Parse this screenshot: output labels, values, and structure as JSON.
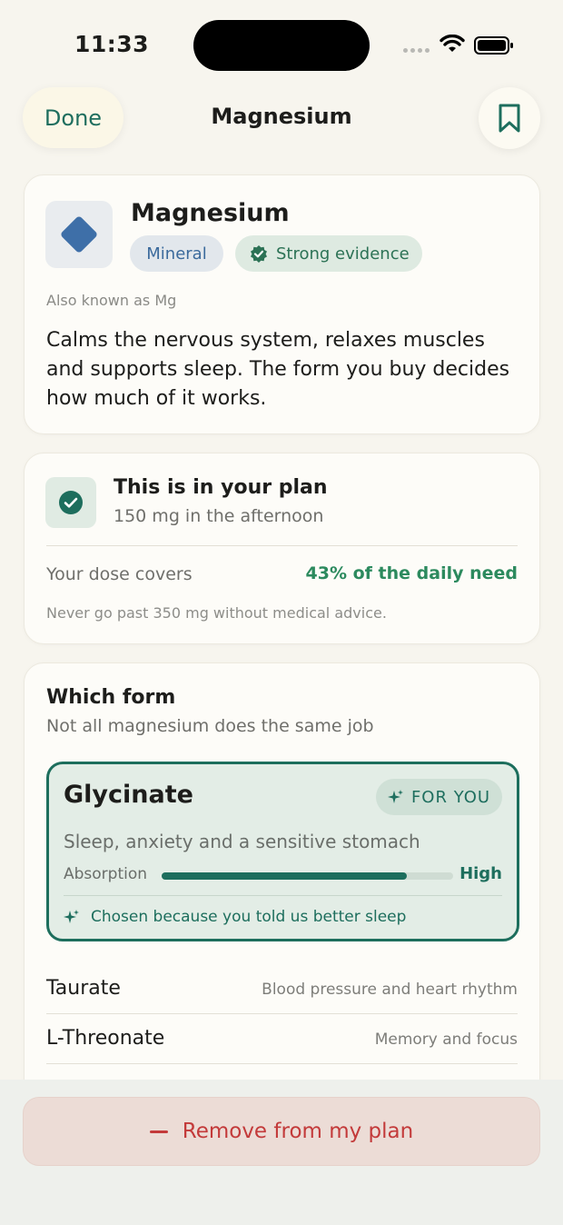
{
  "status_bar": {
    "time": "11:33"
  },
  "nav": {
    "done_label": "Done",
    "title": "Magnesium"
  },
  "supplement": {
    "name": "Magnesium",
    "category": "Mineral",
    "evidence": "Strong evidence",
    "aka": "Also known as Mg",
    "description": "Calms the nervous system, relaxes muscles and supports sleep. The form you buy decides how much of it works."
  },
  "plan": {
    "title": "This is in your plan",
    "dose": "150 mg in the afternoon",
    "covers_label": "Your dose covers",
    "covers_value": "43% of the daily need",
    "warning": "Never go past 350 mg without medical advice."
  },
  "forms": {
    "title": "Which form",
    "subtitle": "Not all magnesium does the same job",
    "recommended": {
      "name": "Glycinate",
      "badge": "FOR YOU",
      "use": "Sleep, anxiety and a sensitive stomach",
      "absorption_label": "Absorption",
      "absorption_level": 0.84,
      "absorption_value": "High",
      "reason": "Chosen because you told us better sleep"
    },
    "others": [
      {
        "name": "Taurate",
        "use": "Blood pressure and heart rhythm"
      },
      {
        "name": "L-Threonate",
        "use": "Memory and focus"
      }
    ]
  },
  "action": {
    "remove_label": "Remove from my plan"
  },
  "colors": {
    "accent": "#1d6e5d",
    "success": "#2c8a5e",
    "danger": "#c33a3a",
    "mineral_blue": "#3e6fa8"
  }
}
